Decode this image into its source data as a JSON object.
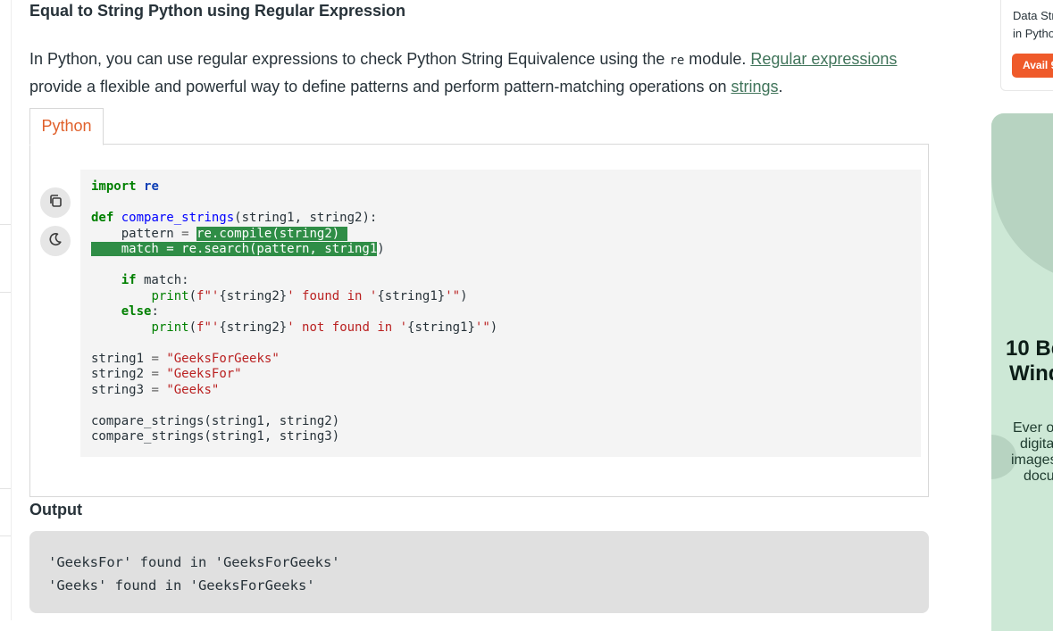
{
  "article": {
    "heading": "Equal to String Python using Regular Expression",
    "paragraph": {
      "part1": "In Python, you can use regular expressions to check Python String Equivalence using the ",
      "code": "re",
      "part2": " module. ",
      "link1": "Regular expressions",
      "part3": " provide a flexible and powerful way to define patterns and perform pattern-matching operations on ",
      "link2": "strings",
      "part4": "."
    }
  },
  "code_tabs": {
    "active_tab": "Python"
  },
  "code_toolbar": {
    "copy_icon": "copy-icon",
    "theme_icon": "moon-icon"
  },
  "code": {
    "line1_kw": "import",
    "line1_mod": "re",
    "line2_kw": "def",
    "line2_fn": "compare_strings",
    "line2_rest": "(string1, string2):",
    "line3_indent": "    pattern ",
    "line3_op": "=",
    "line3_space": " ",
    "line3_sel": "re.compile(string2)",
    "line4_sel": "    match = re.search(pattern, string1",
    "line4_rest": ")",
    "line5_kw": "if",
    "line5_rest": " match:",
    "line6_fn": "print",
    "line6_paren": "(",
    "line6_s1": "f\"'",
    "line6_i1": "{string2}",
    "line6_s2": "' found in '",
    "line6_i2": "{string1}",
    "line6_s3": "'\"",
    "line6_end": ")",
    "line7_kw": "else",
    "line7_rest": ":",
    "line8_fn": "print",
    "line8_paren": "(",
    "line8_s1": "f\"'",
    "line8_i1": "{string2}",
    "line8_s2": "' not found in '",
    "line8_i2": "{string1}",
    "line8_s3": "'\"",
    "line8_end": ")",
    "line9_name": "string1 ",
    "line9_op": "=",
    "line9_str": "\"GeeksForGeeks\"",
    "line10_name": "string2 ",
    "line10_op": "=",
    "line10_str": "\"GeeksFor\"",
    "line11_name": "string3 ",
    "line11_op": "=",
    "line11_str": "\"Geeks\"",
    "line12": "compare_strings(string1, string2)",
    "line13": "compare_strings(string1, string3)"
  },
  "output": {
    "label": "Output",
    "lines": [
      "'GeeksFor' found in 'GeeksForGeeks'",
      "'Geeks' found in 'GeeksForGeeks'"
    ]
  },
  "sidebar_card": {
    "line1": "Data Str",
    "line2": "in Pytho",
    "button": "Avail 9"
  },
  "ad": {
    "title1": "10 Be",
    "title2": "Wind",
    "desc": [
      "Ever o",
      "digita",
      "images",
      "docu"
    ],
    "colors": {
      "background": "#cde8d6",
      "accent": "#b7d3c1"
    }
  },
  "colors": {
    "tab_active": "#e0612c",
    "link": "#40745a",
    "selection": "#2f8d46",
    "button": "#ef5a2a"
  }
}
